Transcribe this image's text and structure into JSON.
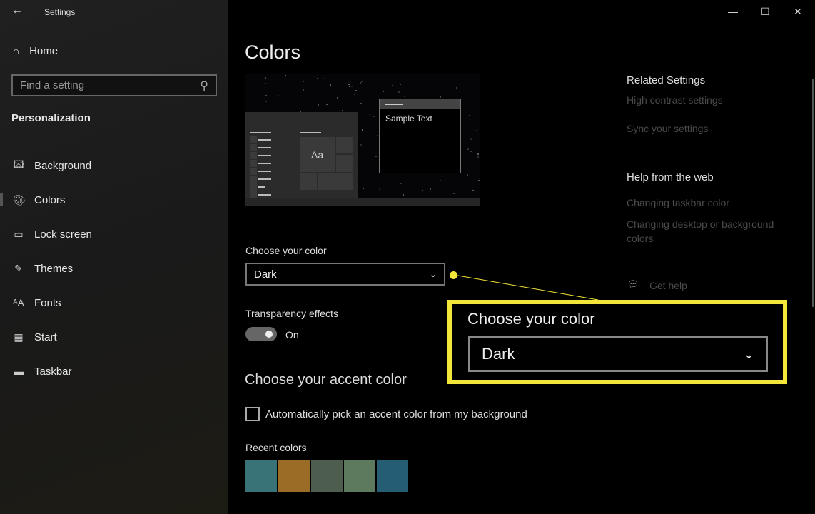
{
  "window": {
    "title": "Settings",
    "back_icon": "arrow-left-icon",
    "minimize": "—",
    "maximize": "☐",
    "close": "✕"
  },
  "sidebar": {
    "home_label": "Home",
    "search_placeholder": "Find a setting",
    "section": "Personalization",
    "items": [
      {
        "label": "Background",
        "icon": "picture-icon"
      },
      {
        "label": "Colors",
        "icon": "palette-icon",
        "active": true
      },
      {
        "label": "Lock screen",
        "icon": "lock-screen-icon"
      },
      {
        "label": "Themes",
        "icon": "themes-icon"
      },
      {
        "label": "Fonts",
        "icon": "fonts-icon"
      },
      {
        "label": "Start",
        "icon": "start-icon"
      },
      {
        "label": "Taskbar",
        "icon": "taskbar-icon"
      }
    ]
  },
  "main": {
    "title": "Colors",
    "preview": {
      "sample_text": "Sample Text",
      "tile_text": "Aa"
    },
    "choose_color_label": "Choose your color",
    "choose_color_value": "Dark",
    "transparency_label": "Transparency effects",
    "transparency_state": "On",
    "accent_heading": "Choose your accent color",
    "auto_pick_label": "Automatically pick an accent color from my background",
    "auto_pick_checked": false,
    "recent_colors_label": "Recent colors",
    "recent_colors": [
      "#3a7377",
      "#9a6c25",
      "#4d5e4f",
      "#5e7a5e",
      "#245d74"
    ]
  },
  "related": {
    "heading": "Related Settings",
    "links": [
      "High contrast settings",
      "Sync your settings"
    ],
    "help_heading": "Help from the web",
    "help_links": [
      "Changing taskbar color",
      "Changing desktop or background colors"
    ],
    "get_help": "Get help"
  },
  "callout": {
    "title": "Choose your color",
    "value": "Dark",
    "color": "#f3e53a"
  }
}
